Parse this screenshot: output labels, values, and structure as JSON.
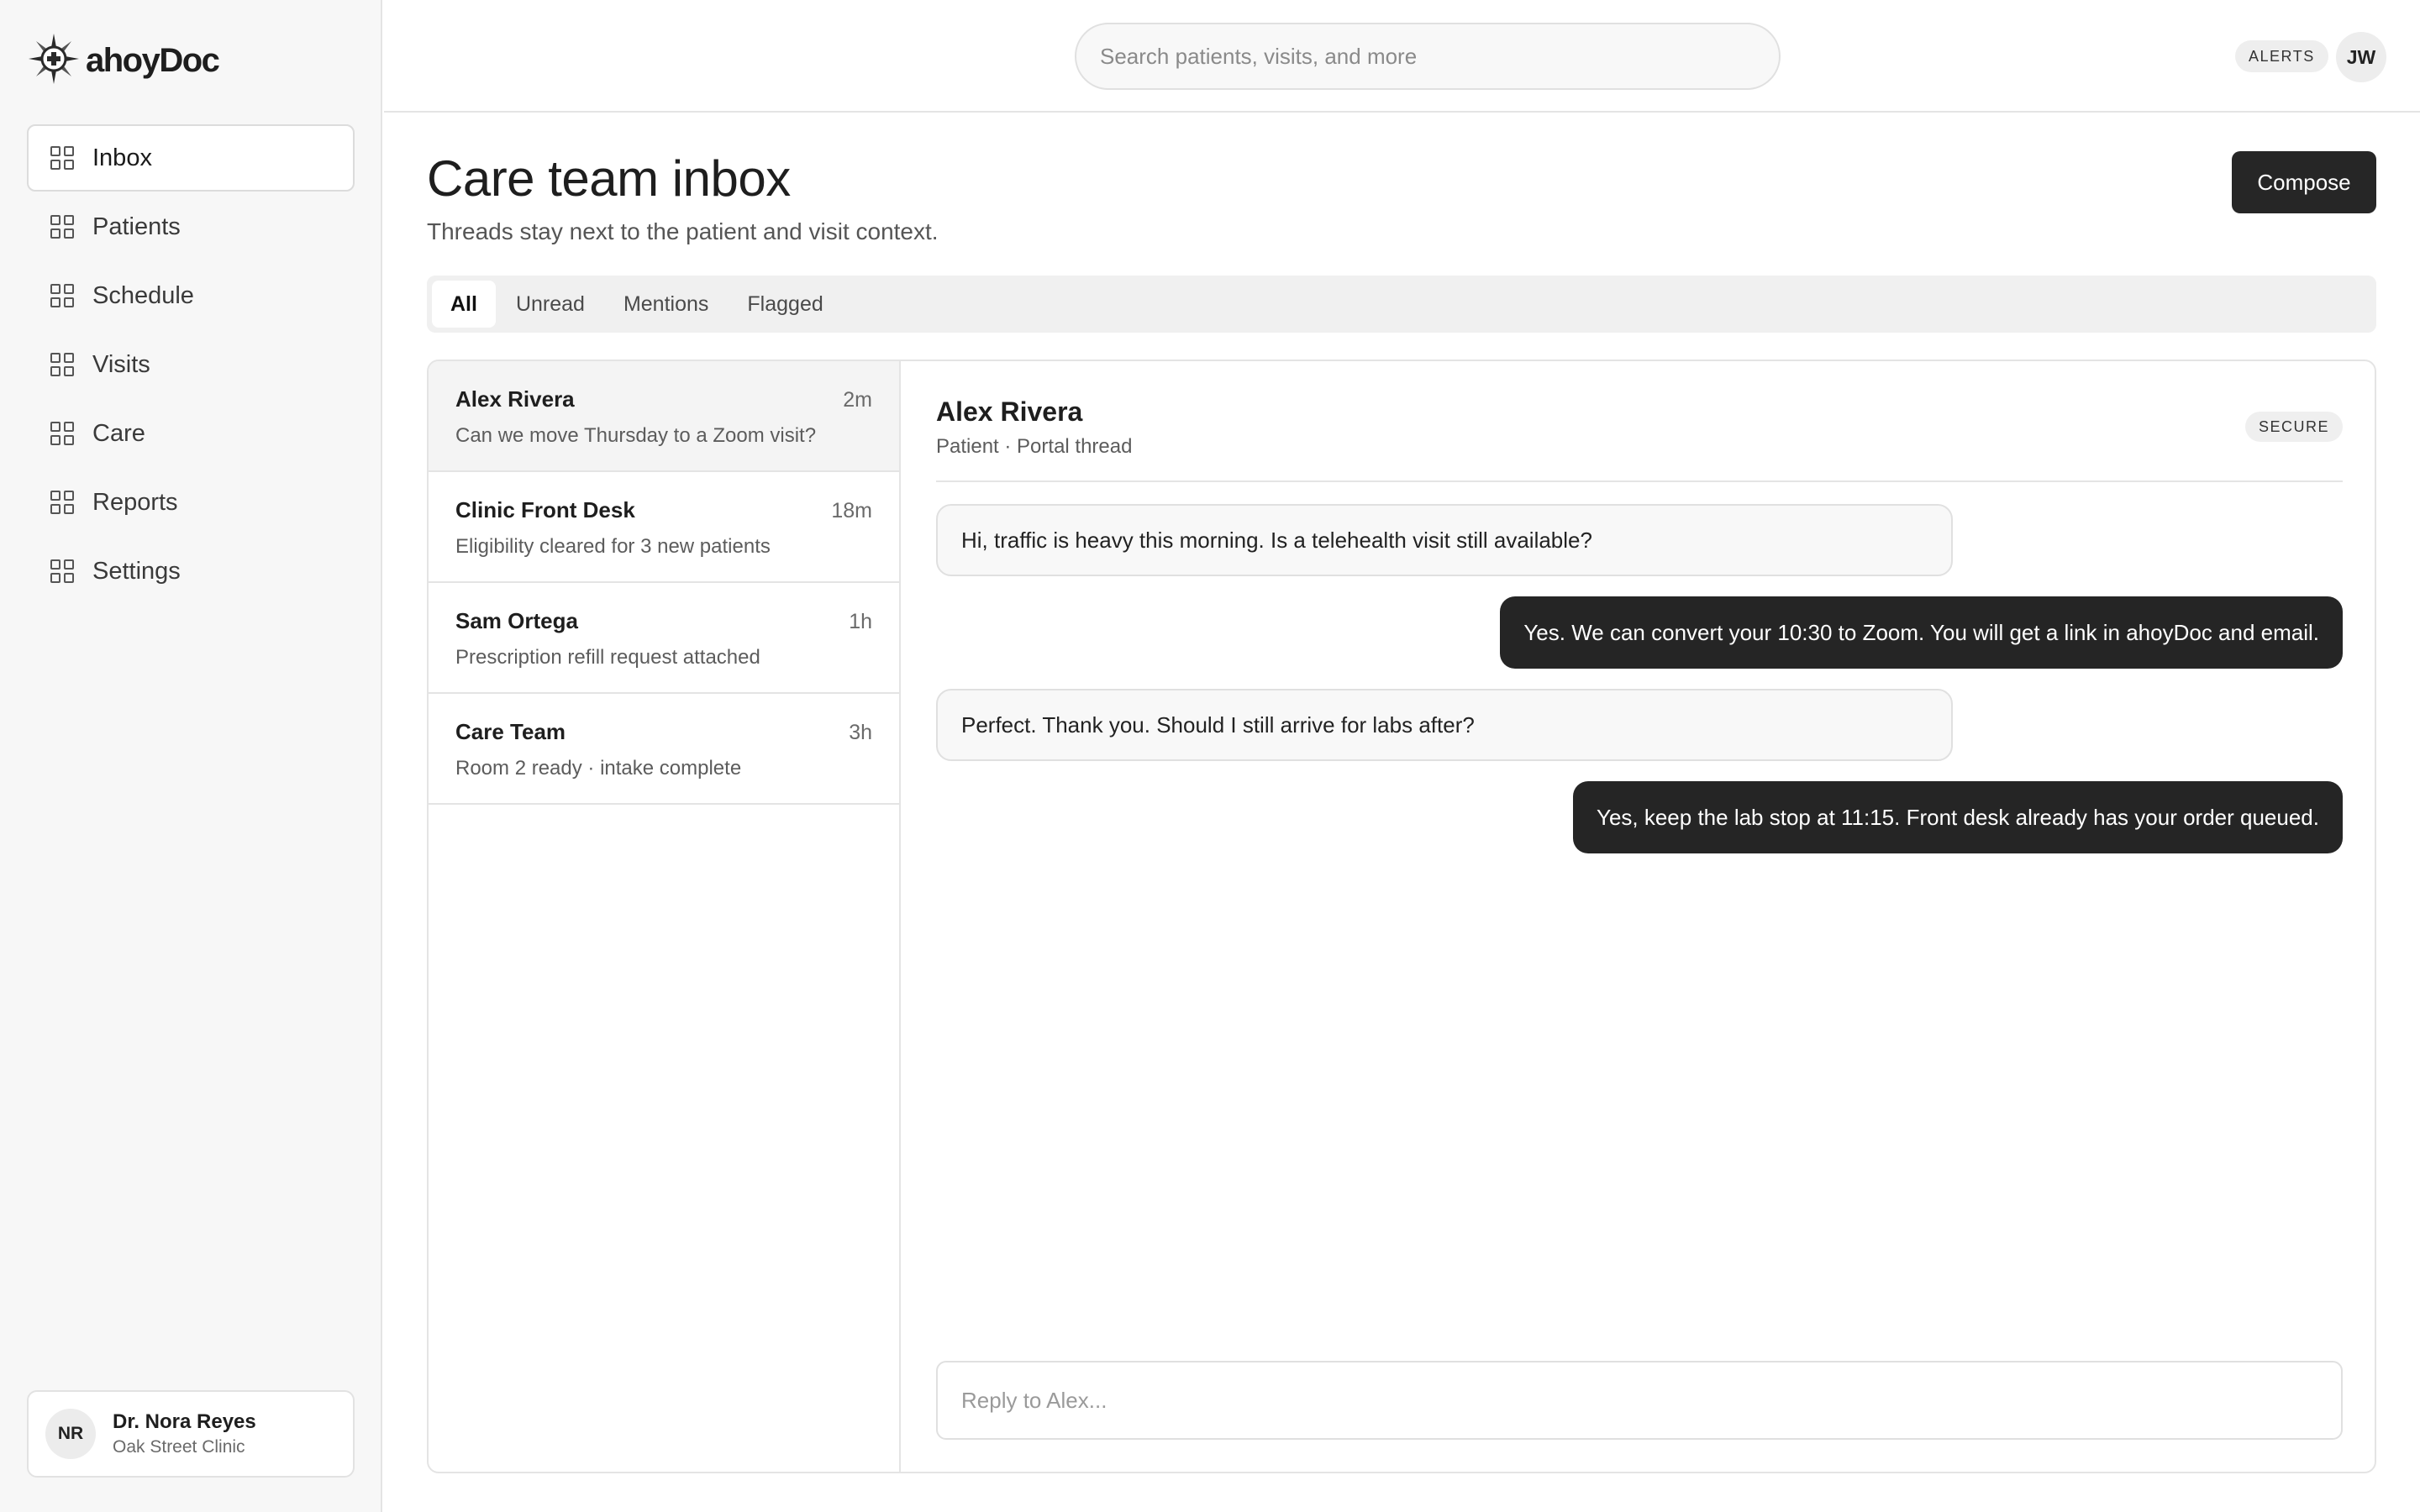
{
  "brand": {
    "name": "ahoyDoc",
    "logo_icon": "compass-icon"
  },
  "sidebar": {
    "items": [
      {
        "label": "Inbox",
        "icon": "grid-icon",
        "active": true
      },
      {
        "label": "Patients",
        "icon": "grid-icon"
      },
      {
        "label": "Schedule",
        "icon": "grid-icon"
      },
      {
        "label": "Visits",
        "icon": "grid-icon"
      },
      {
        "label": "Care",
        "icon": "grid-icon"
      },
      {
        "label": "Reports",
        "icon": "grid-icon"
      },
      {
        "label": "Settings",
        "icon": "grid-icon"
      }
    ],
    "user": {
      "initials": "NR",
      "name": "Dr. Nora Reyes",
      "org": "Oak Street Clinic"
    }
  },
  "topbar": {
    "search_placeholder": "Search patients, visits, and more",
    "alerts_label": "ALERTS",
    "avatar_initials": "JW"
  },
  "main": {
    "title": "Care team inbox",
    "subtitle": "Threads stay next to the patient and visit context.",
    "compose_label": "Compose",
    "tabs": [
      {
        "label": "All",
        "active": true
      },
      {
        "label": "Unread"
      },
      {
        "label": "Mentions"
      },
      {
        "label": "Flagged"
      }
    ],
    "threads": [
      {
        "name": "Alex Rivera",
        "time": "2m",
        "preview": "Can we move Thursday to a Zoom visit?",
        "active": true
      },
      {
        "name": "Clinic Front Desk",
        "time": "18m",
        "preview": "Eligibility cleared for 3 new patients"
      },
      {
        "name": "Sam Ortega",
        "time": "1h",
        "preview": "Prescription refill request attached"
      },
      {
        "name": "Care Team",
        "time": "3h",
        "preview": "Room 2 ready · intake complete"
      }
    ],
    "conversation": {
      "name": "Alex Rivera",
      "meta": "Patient · Portal thread",
      "badge": "SECURE",
      "messages": [
        {
          "direction": "in",
          "text": "Hi, traffic is heavy this morning. Is a telehealth visit still available?"
        },
        {
          "direction": "out",
          "text": "Yes. We can convert your 10:30 to Zoom. You will get a link in ahoyDoc and email."
        },
        {
          "direction": "in",
          "text": "Perfect. Thank you. Should I still arrive for labs after?"
        },
        {
          "direction": "out",
          "text": "Yes, keep the lab stop at 11:15. Front desk already has your order queued."
        }
      ],
      "reply_placeholder": "Reply to Alex..."
    }
  },
  "colors": {
    "primary_dark": "#262626",
    "sidebar_bg": "#f7f7f7",
    "border": "#e4e4e4"
  }
}
